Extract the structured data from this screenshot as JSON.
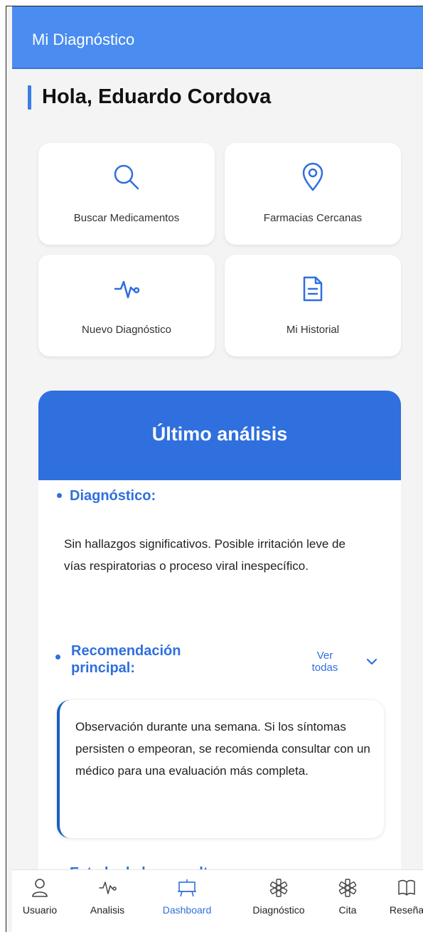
{
  "app": {
    "title": "Mi Diagnóstico"
  },
  "greeting": "Hola, Eduardo Cordova",
  "tiles": [
    {
      "label": "Buscar Medicamentos",
      "icon": "search-icon"
    },
    {
      "label": "Farmacias Cercanas",
      "icon": "location-pin-icon"
    },
    {
      "label": "Nuevo Diagnóstico",
      "icon": "pulse-icon"
    },
    {
      "label": "Mi Historial",
      "icon": "document-icon"
    }
  ],
  "analysis": {
    "title": "Último análisis",
    "diagnosis_title": "Diagnóstico:",
    "diagnosis_text": "Sin hallazgos significativos. Posible irritación leve de vías respiratorias o proceso viral inespecífico.",
    "recommendation_title_line1": "Recomendación",
    "recommendation_title_line2": "principal:",
    "view_all_line1": "Ver",
    "view_all_line2": "todas",
    "recommendation_text": "Observación durante una semana. Si los síntomas persisten o empeoran, se recomienda consultar con un médico para una evaluación más completa.",
    "status_title": "Estado de la consulta:"
  },
  "bottom_nav": [
    {
      "label": "Usuario",
      "icon": "user-icon"
    },
    {
      "label": "Analisis",
      "icon": "pulse-icon"
    },
    {
      "label": "Dashboard",
      "icon": "presentation-board-icon",
      "active": true
    },
    {
      "label": "Diagnóstico",
      "icon": "asterisk-icon"
    },
    {
      "label": "Cita",
      "icon": "asterisk-icon"
    },
    {
      "label": "Reseña",
      "icon": "book-icon"
    }
  ],
  "colors": {
    "primary": "#2f6fde",
    "appbar": "#4a8cf0",
    "background": "#f4f4f4"
  }
}
